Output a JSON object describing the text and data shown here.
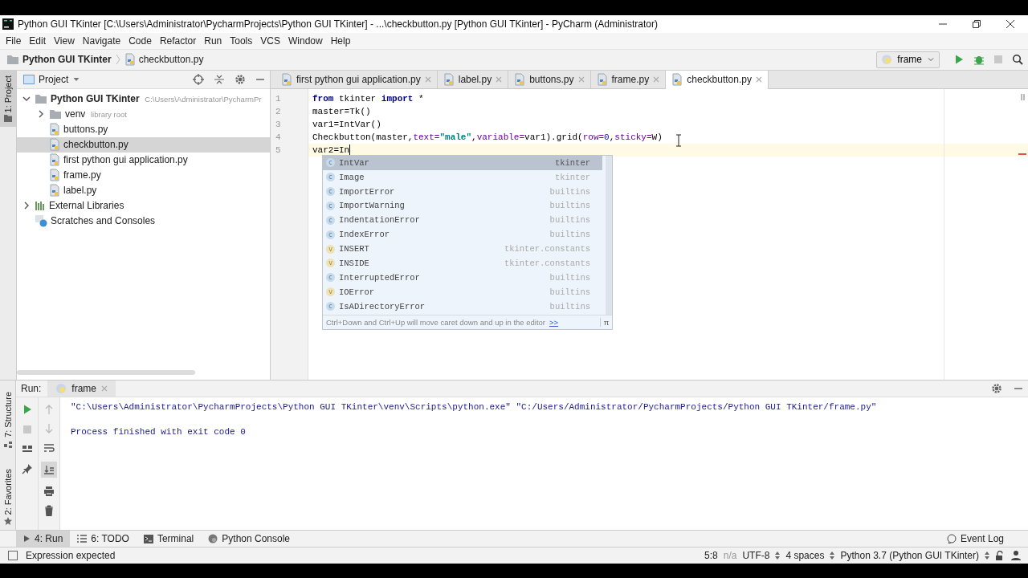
{
  "window": {
    "title": "Python GUI TKinter [C:\\Users\\Administrator\\PycharmProjects\\Python GUI TKinter] - ...\\checkbutton.py [Python GUI TKinter] - PyCharm (Administrator)"
  },
  "menu": [
    "File",
    "Edit",
    "View",
    "Navigate",
    "Code",
    "Refactor",
    "Run",
    "Tools",
    "VCS",
    "Window",
    "Help"
  ],
  "breadcrumbs": [
    {
      "label": "Python GUI TKinter",
      "kind": "folder"
    },
    {
      "label": "checkbutton.py",
      "kind": "file"
    }
  ],
  "run_config": {
    "label": "frame"
  },
  "left_strip": {
    "top": "1: Project",
    "bottom": [
      "7: Structure",
      "2: Favorites"
    ]
  },
  "project_panel": {
    "title": "Project",
    "tree": [
      {
        "label": "Python GUI TKinter",
        "hint": "C:\\Users\\Administrator\\PycharmPr",
        "kind": "root",
        "expanded": true,
        "selected": false,
        "children": [
          {
            "label": "venv",
            "hint": "library root",
            "kind": "folder",
            "expanded": false,
            "selected": false
          },
          {
            "label": "buttons.py",
            "kind": "file",
            "selected": false
          },
          {
            "label": "checkbutton.py",
            "kind": "file",
            "selected": true
          },
          {
            "label": "first python gui application.py",
            "kind": "file",
            "selected": false
          },
          {
            "label": "frame.py",
            "kind": "file",
            "selected": false
          },
          {
            "label": "label.py",
            "kind": "file",
            "selected": false
          }
        ]
      },
      {
        "label": "External Libraries",
        "kind": "library",
        "expanded": false,
        "selected": false
      },
      {
        "label": "Scratches and Consoles",
        "kind": "scratch",
        "selected": false
      }
    ]
  },
  "editor": {
    "tabs": [
      {
        "label": "first python gui application.py",
        "selected": false
      },
      {
        "label": "label.py",
        "selected": false
      },
      {
        "label": "buttons.py",
        "selected": false
      },
      {
        "label": "frame.py",
        "selected": false
      },
      {
        "label": "checkbutton.py",
        "selected": true
      }
    ],
    "lines": [
      {
        "number": "1",
        "current": false,
        "tokens": [
          {
            "text": "from",
            "kind": "keyword"
          },
          {
            "text": " tkinter ",
            "kind": "plain"
          },
          {
            "text": "import",
            "kind": "keyword"
          },
          {
            "text": " *",
            "kind": "plain"
          }
        ]
      },
      {
        "number": "2",
        "current": false,
        "tokens": [
          {
            "text": "master=Tk()",
            "kind": "plain"
          }
        ]
      },
      {
        "number": "3",
        "current": false,
        "tokens": [
          {
            "text": "var1=IntVar()",
            "kind": "plain"
          }
        ]
      },
      {
        "number": "4",
        "current": false,
        "tokens": [
          {
            "text": "Checkbutton(master,",
            "kind": "plain"
          },
          {
            "text": "text=",
            "kind": "param"
          },
          {
            "text": "\"male\"",
            "kind": "string"
          },
          {
            "text": ",",
            "kind": "plain"
          },
          {
            "text": "variable=",
            "kind": "param"
          },
          {
            "text": "var1).grid(",
            "kind": "plain"
          },
          {
            "text": "row=",
            "kind": "param"
          },
          {
            "text": "0",
            "kind": "number"
          },
          {
            "text": ",",
            "kind": "plain"
          },
          {
            "text": "sticky=",
            "kind": "param"
          },
          {
            "text": "W)",
            "kind": "plain"
          }
        ]
      },
      {
        "number": "5",
        "current": true,
        "tokens": [
          {
            "text": "var2=In",
            "kind": "plain"
          }
        ]
      }
    ],
    "completion": {
      "items": [
        {
          "badge": "c",
          "name": "IntVar",
          "source": "tkinter",
          "selected": true
        },
        {
          "badge": "c",
          "name": "Image",
          "source": "tkinter",
          "selected": false
        },
        {
          "badge": "c",
          "name": "ImportError",
          "source": "builtins",
          "selected": false
        },
        {
          "badge": "c",
          "name": "ImportWarning",
          "source": "builtins",
          "selected": false
        },
        {
          "badge": "c",
          "name": "IndentationError",
          "source": "builtins",
          "selected": false
        },
        {
          "badge": "c",
          "name": "IndexError",
          "source": "builtins",
          "selected": false
        },
        {
          "badge": "v",
          "name": "INSERT",
          "source": "tkinter.constants",
          "selected": false
        },
        {
          "badge": "v",
          "name": "INSIDE",
          "source": "tkinter.constants",
          "selected": false
        },
        {
          "badge": "c",
          "name": "InterruptedError",
          "source": "builtins",
          "selected": false
        },
        {
          "badge": "v",
          "name": "IOError",
          "source": "builtins",
          "selected": false
        },
        {
          "badge": "c",
          "name": "IsADirectoryError",
          "source": "builtins",
          "selected": false
        }
      ],
      "hint": "Ctrl+Down and Ctrl+Up will move caret down and up in the editor",
      "link": ">>",
      "pin": "π"
    }
  },
  "run_panel": {
    "label": "Run:",
    "tab": "frame",
    "output": [
      {
        "text": "\"C:\\Users\\Administrator\\PycharmProjects\\Python GUI TKinter\\venv\\Scripts\\python.exe\" \"C:/Users/Administrator/PycharmProjects/Python GUI TKinter/frame.py\""
      },
      {
        "text": "Process finished with exit code 0"
      }
    ]
  },
  "tool_tabs": [
    {
      "label": "4: Run",
      "kind": "run",
      "selected": true
    },
    {
      "label": "6: TODO",
      "kind": "todo",
      "selected": false
    },
    {
      "label": "Terminal",
      "kind": "terminal",
      "selected": false
    },
    {
      "label": "Python Console",
      "kind": "console",
      "selected": false
    }
  ],
  "event_log": "Event Log",
  "status_bar": {
    "message": "Expression expected",
    "position": "5:8",
    "vcs": "n/a",
    "encoding": "UTF-8",
    "indent": "4 spaces",
    "interpreter": "Python 3.7 (Python GUI TKinter)"
  }
}
